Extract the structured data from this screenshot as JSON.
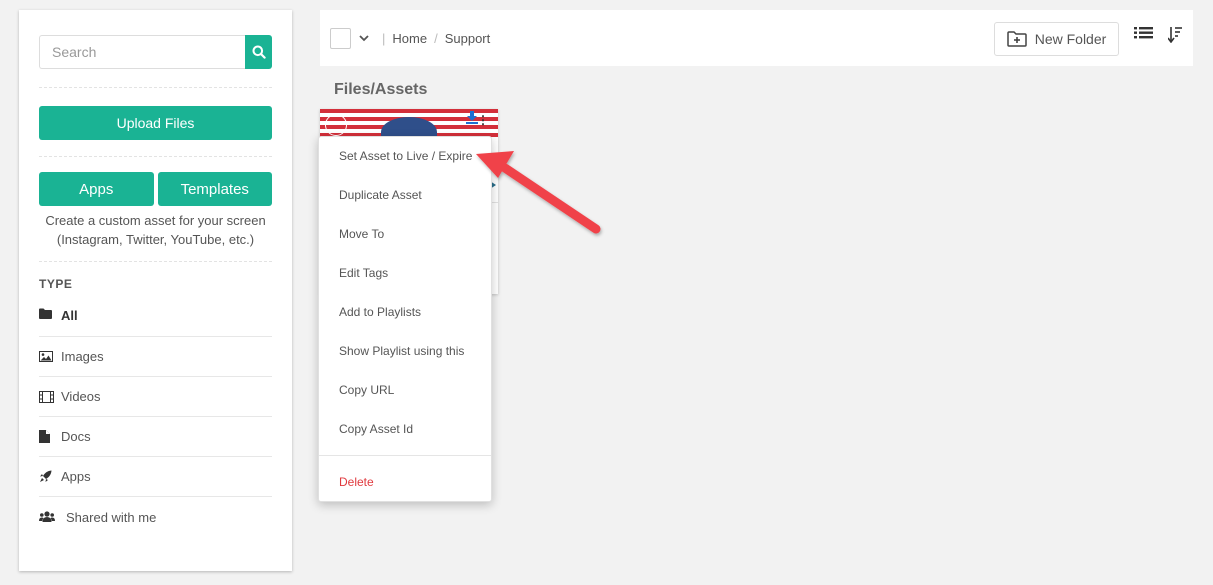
{
  "sidebar": {
    "search": {
      "placeholder": "Search"
    },
    "upload_label": "Upload Files",
    "apps_label": "Apps",
    "templates_label": "Templates",
    "custom_text": "Create a custom asset for your screen (Instagram, Twitter, YouTube, etc.)",
    "type_title": "TYPE",
    "types": [
      {
        "label": "All",
        "icon": "folder-icon",
        "active": true
      },
      {
        "label": "Images",
        "icon": "image-icon"
      },
      {
        "label": "Videos",
        "icon": "film-icon"
      },
      {
        "label": "Docs",
        "icon": "document-icon"
      },
      {
        "label": "Apps",
        "icon": "rocket-icon"
      },
      {
        "label": "Shared with me",
        "icon": "users-icon"
      }
    ]
  },
  "topbar": {
    "breadcrumb": [
      "Home",
      "Support"
    ],
    "new_folder_label": "New Folder"
  },
  "main": {
    "section_title": "Files/Assets"
  },
  "context_menu": {
    "items": [
      "Set Asset to Live / Expire",
      "Duplicate Asset",
      "Move To",
      "Edit Tags",
      "Add to Playlists",
      "Show Playlist using this",
      "Copy URL",
      "Copy Asset Id"
    ],
    "delete_label": "Delete"
  },
  "colors": {
    "accent": "#1ab394",
    "danger": "#e0393e",
    "arrow": "#f0434a"
  }
}
